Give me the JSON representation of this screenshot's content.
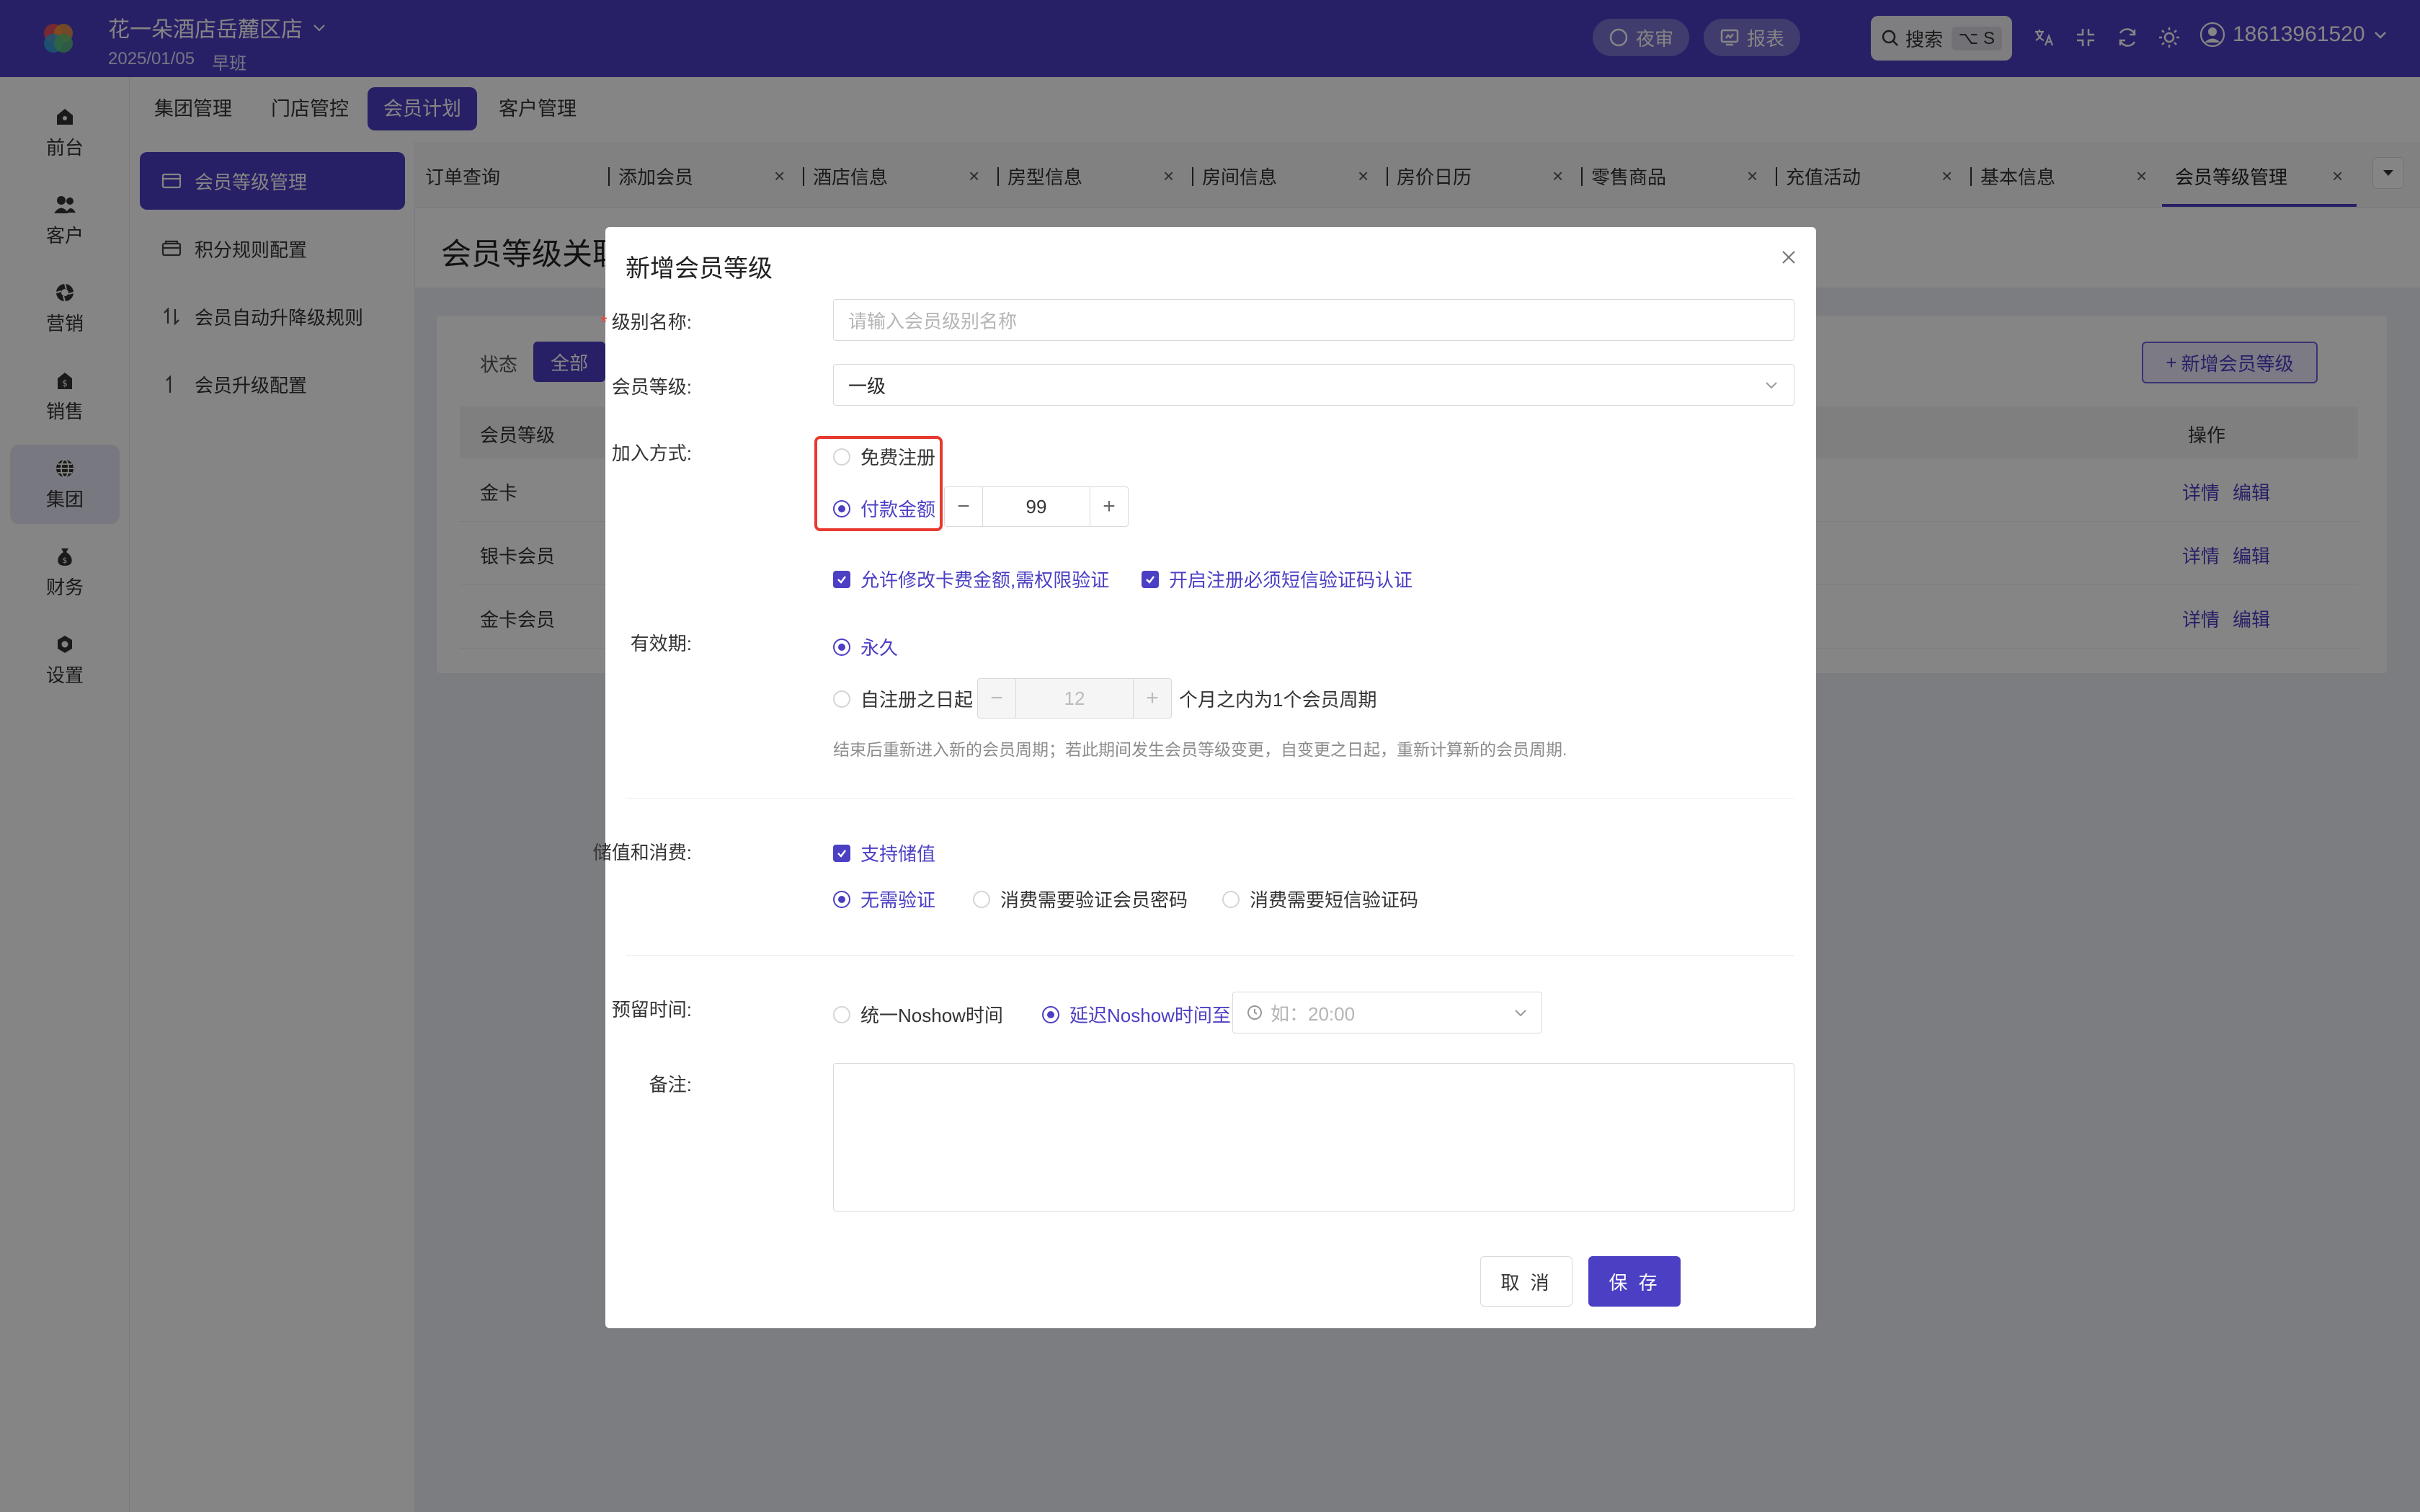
{
  "header": {
    "hotel_name": "花一朵酒店岳麓区店",
    "date": "2025/01/05",
    "shift": "早班",
    "night_audit": "夜审",
    "report": "报表",
    "search_label": "搜索",
    "search_shortcut": "⌥ S",
    "user_phone": "18613961520"
  },
  "main_nav": [
    {
      "label": "前台"
    },
    {
      "label": "客户"
    },
    {
      "label": "营销"
    },
    {
      "label": "销售"
    },
    {
      "label": "集团"
    },
    {
      "label": "财务"
    },
    {
      "label": "设置"
    }
  ],
  "top_tabs": [
    "集团管理",
    "门店管控",
    "会员计划",
    "客户管理"
  ],
  "sidebar": [
    "会员等级管理",
    "积分规则配置",
    "会员自动升降级规则",
    "会员升级配置"
  ],
  "page_tabs": [
    "订单查询",
    "添加会员",
    "酒店信息",
    "房型信息",
    "房间信息",
    "房价日历",
    "零售商品",
    "充值活动",
    "基本信息",
    "会员等级管理"
  ],
  "page": {
    "title": "会员等级关联",
    "status_label": "状态",
    "status_all": "全部",
    "add_button": "新增会员等级",
    "table_headers": [
      "会员等级",
      "操作"
    ],
    "rows": [
      {
        "name": "金卡",
        "detail": "详情",
        "edit": "编辑"
      },
      {
        "name": "银卡会员",
        "detail": "详情",
        "edit": "编辑"
      },
      {
        "name": "金卡会员",
        "detail": "详情",
        "edit": "编辑"
      }
    ]
  },
  "modal": {
    "title": "新增会员等级",
    "level_name_label": "级别名称:",
    "level_name_placeholder": "请输入会员级别名称",
    "member_level_label": "会员等级:",
    "member_level_value": "一级",
    "join_label": "加入方式:",
    "join_free": "免费注册",
    "join_paid": "付款金额",
    "paid_amount": "99",
    "allow_modify": "允许修改卡费金额,需权限验证",
    "sms_required": "开启注册必须短信验证码认证",
    "validity_label": "有效期:",
    "validity_forever": "永久",
    "validity_from_reg": "自注册之日起",
    "validity_months": "12",
    "validity_suffix": "个月之内为1个会员周期",
    "validity_hint": "结束后重新进入新的会员周期；若此期间发生会员等级变更，自变更之日起，重新计算新的会员周期.",
    "stored_label": "储值和消费:",
    "stored_support": "支持储值",
    "verify_none": "无需验证",
    "verify_pwd": "消费需要验证会员密码",
    "verify_sms": "消费需要短信验证码",
    "reserve_label": "预留时间:",
    "reserve_uniform": "统一Noshow时间",
    "reserve_delay": "延迟Noshow时间至",
    "reserve_placeholder": "如：20:00",
    "remark_label": "备注:",
    "cancel": "取 消",
    "save": "保 存"
  },
  "colors": {
    "brand": "#4b3fc4",
    "highlight": "#e8392f"
  }
}
